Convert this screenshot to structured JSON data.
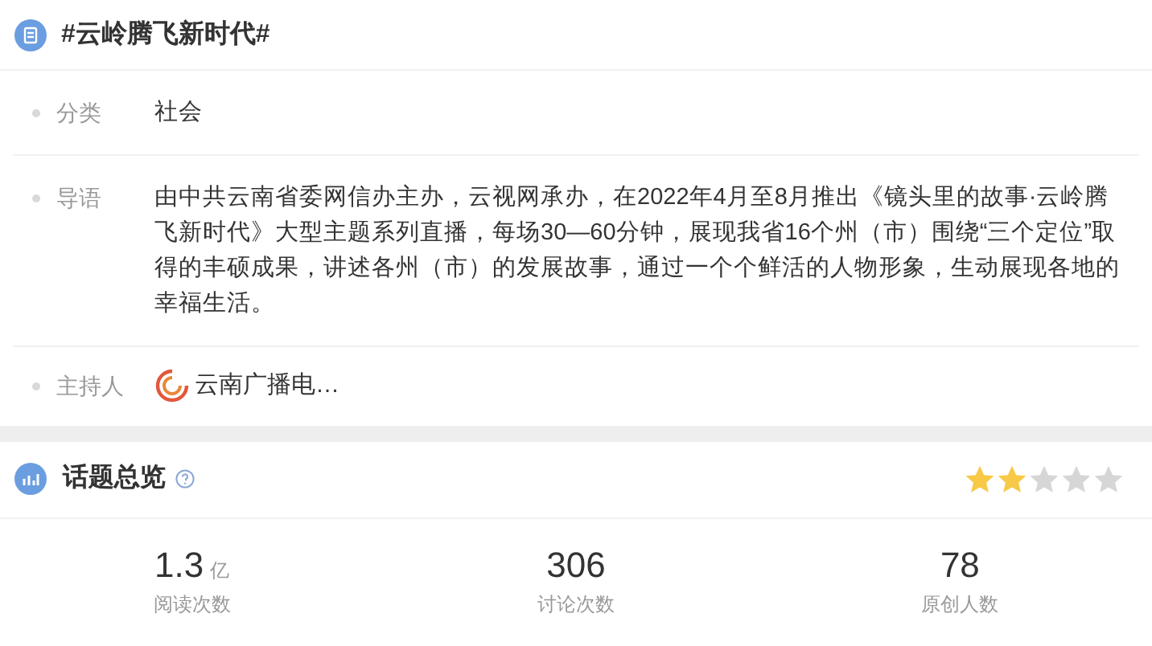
{
  "topic": {
    "title": "#云岭腾飞新时代#"
  },
  "info_rows": [
    {
      "kind": "text",
      "label": "分类",
      "value": "社会"
    },
    {
      "kind": "text",
      "label": "导语",
      "value": "由中共云南省委网信办主办，云视网承办，在2022年4月至8月推出《镜头里的故事·云岭腾飞新时代》大型主题系列直播，每场30—60分钟，展现我省16个州（市）围绕“三个定位”取得的丰硕成果，讲述各州（市）的发展故事，通过一个个鲜活的人物形象，生动展现各地的幸福生活。"
    },
    {
      "kind": "host",
      "label": "主持人",
      "value": "云南广播电…"
    }
  ],
  "overview": {
    "title": "话题总览",
    "stars": 2,
    "stats": [
      {
        "value": "1.3",
        "unit": "亿",
        "label": "阅读次数"
      },
      {
        "value": "306",
        "label": "讨论次数"
      },
      {
        "value": "78",
        "label": "原创人数"
      }
    ]
  }
}
